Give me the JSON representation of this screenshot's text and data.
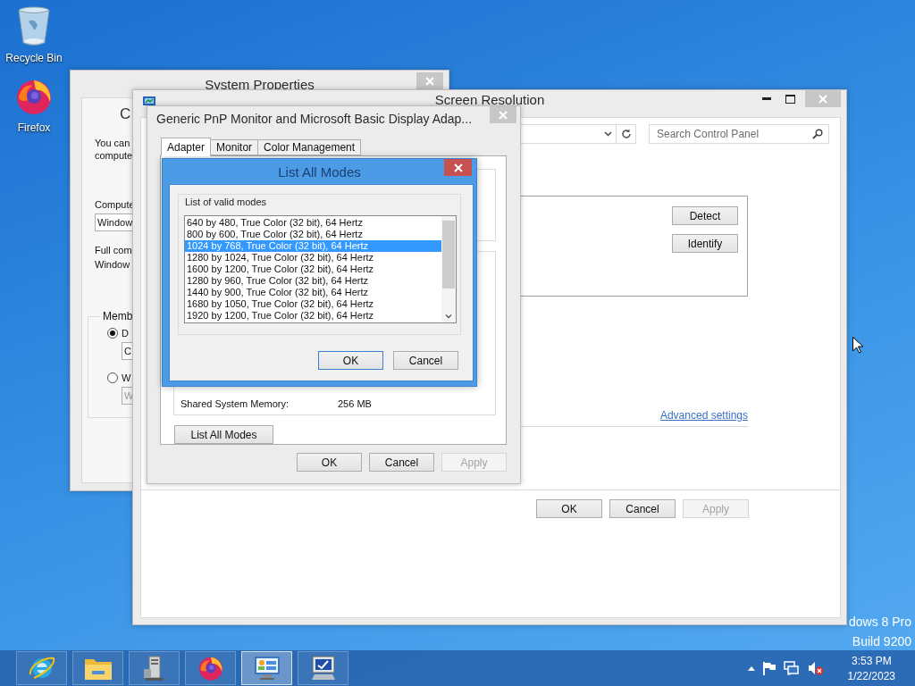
{
  "desktop": {
    "icons": [
      {
        "kind": "recycle",
        "label": "Recycle Bin"
      },
      {
        "kind": "firefox",
        "label": "Firefox"
      }
    ],
    "watermark": [
      "dows 8 Pro",
      "Build 9200"
    ]
  },
  "system_properties": {
    "title": "System Properties",
    "tab_heading": "C",
    "intro": [
      "You can",
      "compute"
    ],
    "computer_label": "Compute",
    "computer_field": "Window",
    "full_name": [
      "Full com",
      "Window"
    ],
    "member_group": {
      "label": "Memb",
      "options": [
        {
          "label": "D",
          "selected": true,
          "field": "C",
          "disabled": false
        },
        {
          "label": "W",
          "selected": false,
          "field": "W",
          "disabled": true
        }
      ]
    }
  },
  "screen_resolution": {
    "title": "Screen Resolution",
    "search": {
      "placeholder": "Search Control Panel"
    },
    "panel_buttons": [
      "Detect",
      "Identify"
    ],
    "link": "Advanced settings",
    "buttons": [
      {
        "label": "OK",
        "disabled": false
      },
      {
        "label": "Cancel",
        "disabled": false
      },
      {
        "label": "Apply",
        "disabled": true
      }
    ]
  },
  "display_dialog": {
    "title": "Generic PnP Monitor and Microsoft Basic Display Adap...",
    "tabs": [
      {
        "label": "Adapter",
        "selected": true
      },
      {
        "label": "Monitor",
        "selected": false
      },
      {
        "label": "Color Management",
        "selected": false
      }
    ],
    "memory": {
      "label": "Shared System Memory:",
      "value": "256 MB"
    },
    "list_button": "List All Modes",
    "buttons": [
      {
        "label": "OK",
        "disabled": false
      },
      {
        "label": "Cancel",
        "disabled": false
      },
      {
        "label": "Apply",
        "disabled": true
      }
    ]
  },
  "list_modes": {
    "title": "List All Modes",
    "group": "List of valid modes",
    "modes": [
      {
        "text": "640 by 480, True Color (32 bit), 64 Hertz",
        "selected": false
      },
      {
        "text": "800 by 600, True Color (32 bit), 64 Hertz",
        "selected": false
      },
      {
        "text": "1024 by 768, True Color (32 bit), 64 Hertz",
        "selected": true
      },
      {
        "text": "1280 by 1024, True Color (32 bit), 64 Hertz",
        "selected": false
      },
      {
        "text": "1600 by 1200, True Color (32 bit), 64 Hertz",
        "selected": false
      },
      {
        "text": "1280 by 960, True Color (32 bit), 64 Hertz",
        "selected": false
      },
      {
        "text": "1440 by 900, True Color (32 bit), 64 Hertz",
        "selected": false
      },
      {
        "text": "1680 by 1050, True Color (32 bit), 64 Hertz",
        "selected": false
      },
      {
        "text": "1920 by 1200, True Color (32 bit), 64 Hertz",
        "selected": false
      }
    ],
    "buttons": [
      {
        "label": "OK",
        "default": true
      },
      {
        "label": "Cancel",
        "default": false
      }
    ]
  },
  "taskbar": {
    "apps": [
      {
        "kind": "browser",
        "selected": false
      },
      {
        "kind": "folder",
        "selected": false
      },
      {
        "kind": "server",
        "selected": false
      },
      {
        "kind": "firefox",
        "selected": false
      },
      {
        "kind": "control",
        "selected": true
      },
      {
        "kind": "display",
        "selected": false
      }
    ],
    "clock": {
      "time": "3:53 PM",
      "date": "1/22/2023"
    }
  }
}
